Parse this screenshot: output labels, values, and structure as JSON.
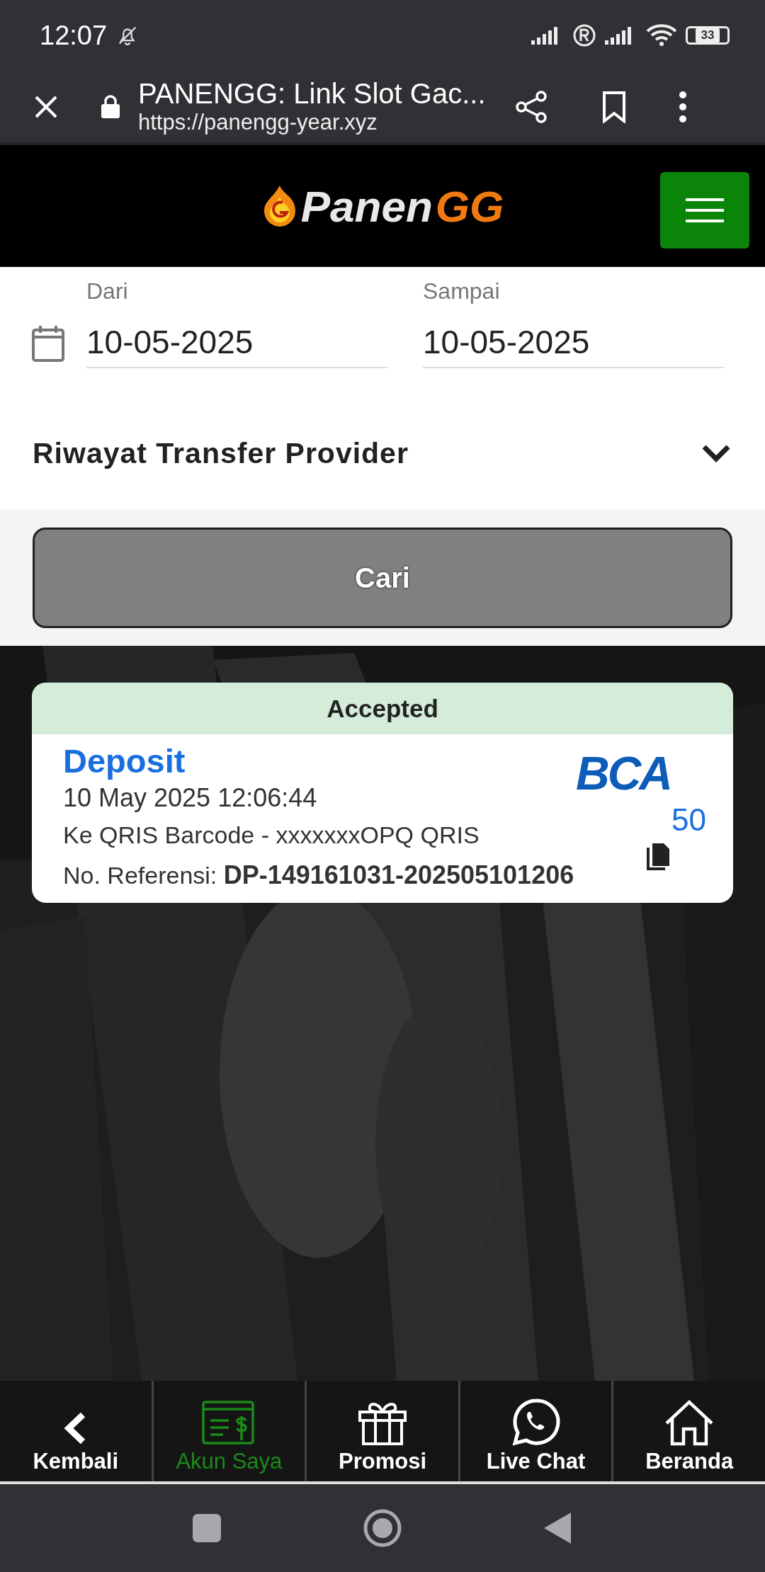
{
  "status_bar": {
    "time": "12:07",
    "battery": "33"
  },
  "browser": {
    "title": "PANENGG: Link Slot Gac...",
    "url": "https://panengg-year.xyz"
  },
  "logo": {
    "text_main": "Panen",
    "text_accent": "GG"
  },
  "date_filter": {
    "from_label": "Dari",
    "from_value": "10-05-2025",
    "to_label": "Sampai",
    "to_value": "10-05-2025"
  },
  "dropdown": {
    "value": "Riwayat Transfer Provider"
  },
  "search_button": "Cari",
  "transactions": [
    {
      "status": "Accepted",
      "type": "Deposit",
      "datetime": "10 May 2025 12:06:44",
      "destination": "Ke QRIS Barcode - xxxxxxxOPQ QRIS",
      "reference_label": "No. Referensi: ",
      "reference": "DP-149161031-202505101206",
      "bank": "BCA",
      "amount": "50"
    }
  ],
  "bottom_nav": [
    {
      "kind": "back",
      "label": "Kembali",
      "selected": false
    },
    {
      "kind": "account",
      "label": "Akun Saya",
      "selected": true
    },
    {
      "kind": "gift",
      "label": "Promosi",
      "selected": false
    },
    {
      "kind": "chat",
      "label": "Live Chat",
      "selected": false
    },
    {
      "kind": "home",
      "label": "Beranda",
      "selected": false
    }
  ]
}
